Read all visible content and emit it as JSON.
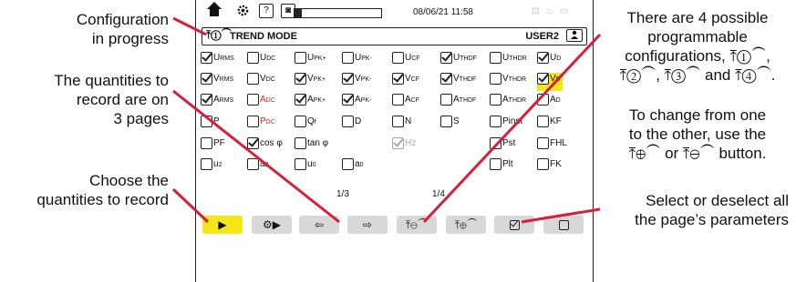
{
  "callouts": {
    "config_line1": "Configuration",
    "config_line2": "in progress",
    "quant_line1": "The quantities to",
    "quant_line2": "record are on",
    "quant_line3": "3 pages",
    "choose_line1": "Choose the",
    "choose_line2": "quantities to record",
    "possible_line1": "There are 4 possible",
    "possible_line2": "programmable",
    "possible_line3": "configurations, ⤒①⁀,",
    "possible_line4": "⤒②⁀, ⤒③⁀ and ⤒④⁀.",
    "change_line1": "To change from one",
    "change_line2": "to the other, use the",
    "change_line3": "⤒⊕⁀ or ⤒⊖⁀ button.",
    "select_line1": "Select or deselect all",
    "select_line2": "the page’s parameters"
  },
  "statusbar": {
    "home_icon": "home-icon",
    "settings_icon": "settings-icon",
    "help_glyph": "?",
    "camera_glyph": "◙",
    "progress": 0.08,
    "datetime": "08/06/21 11:58",
    "device_icons": "⊡ ♨ ▭"
  },
  "mode": {
    "icon": "⤒①⁀",
    "title": "TREND MODE",
    "user": "USER2",
    "user_icon": "user-icon"
  },
  "grid": {
    "col_positions_note": "",
    "rows": [
      [
        {
          "label": "URMS",
          "checked": true
        },
        {
          "label": "UDC",
          "checked": false
        },
        {
          "label": "UPK+",
          "checked": false
        },
        {
          "label": "UPK-",
          "checked": false
        },
        {
          "label": "UCF",
          "checked": false
        },
        {
          "label": "UTHDF",
          "checked": true
        },
        {
          "label": "UTHDR",
          "checked": false
        },
        {
          "label": "UD",
          "checked": true
        }
      ],
      [
        {
          "label": "VRMS",
          "checked": true
        },
        {
          "label": "VDC",
          "checked": false
        },
        {
          "label": "VPK+",
          "checked": true
        },
        {
          "label": "VPK-",
          "checked": true
        },
        {
          "label": "VCF",
          "checked": true
        },
        {
          "label": "VTHDF",
          "checked": true
        },
        {
          "label": "VTHDR",
          "checked": false
        },
        {
          "label": "VD",
          "checked": true,
          "highlight": true
        }
      ],
      [
        {
          "label": "ARMS",
          "checked": true
        },
        {
          "label": "ADC",
          "checked": false,
          "red": true
        },
        {
          "label": "APK+",
          "checked": true
        },
        {
          "label": "APK-",
          "checked": true
        },
        {
          "label": "ACF",
          "checked": false
        },
        {
          "label": "ATHDF",
          "checked": false
        },
        {
          "label": "ATHDR",
          "checked": false
        },
        {
          "label": "AD",
          "checked": false
        }
      ],
      [
        {
          "label": "P",
          "checked": false
        },
        {
          "label": "PDC",
          "checked": false,
          "red": true
        },
        {
          "label": "Qf",
          "checked": false
        },
        {
          "label": "D",
          "checked": false
        },
        {
          "label": "N",
          "checked": false
        },
        {
          "label": "S",
          "checked": false
        },
        {
          "label": "Pinst",
          "checked": false
        },
        {
          "label": "KF",
          "checked": false
        }
      ],
      [
        {
          "label": "PF",
          "checked": false
        },
        {
          "label": "cos φ",
          "checked": true
        },
        {
          "label": "tan φ",
          "checked": false
        },
        null,
        {
          "label": "Hz",
          "checked": true,
          "disabled": true
        },
        null,
        {
          "label": "Pst",
          "checked": false
        },
        {
          "label": "FHL",
          "checked": false
        }
      ],
      [
        {
          "label": "u2",
          "checked": false
        },
        {
          "label": "a2",
          "checked": false
        },
        {
          "label": "u0",
          "checked": false
        },
        {
          "label": "a0",
          "checked": false
        },
        null,
        null,
        {
          "label": "Plt",
          "checked": false
        },
        {
          "label": "FK",
          "checked": false
        }
      ]
    ]
  },
  "pages": {
    "page_a": "1/3",
    "page_b": "1/4"
  },
  "fkeys": [
    {
      "icon": "▶",
      "name": "fkey-next-page",
      "active": true
    },
    {
      "icon": "⚙▶",
      "name": "fkey-settings"
    },
    {
      "icon": "⇦",
      "name": "fkey-load-config"
    },
    {
      "icon": "⇨",
      "name": "fkey-save-config"
    },
    {
      "icon": "⤒⊖⁀",
      "name": "fkey-previous-config"
    },
    {
      "icon": "⤒⊕⁀",
      "name": "fkey-next-config"
    },
    {
      "icon": "",
      "name": "fkey-select-all",
      "box": "checked"
    },
    {
      "icon": "",
      "name": "fkey-deselect-all",
      "box": "empty"
    }
  ]
}
